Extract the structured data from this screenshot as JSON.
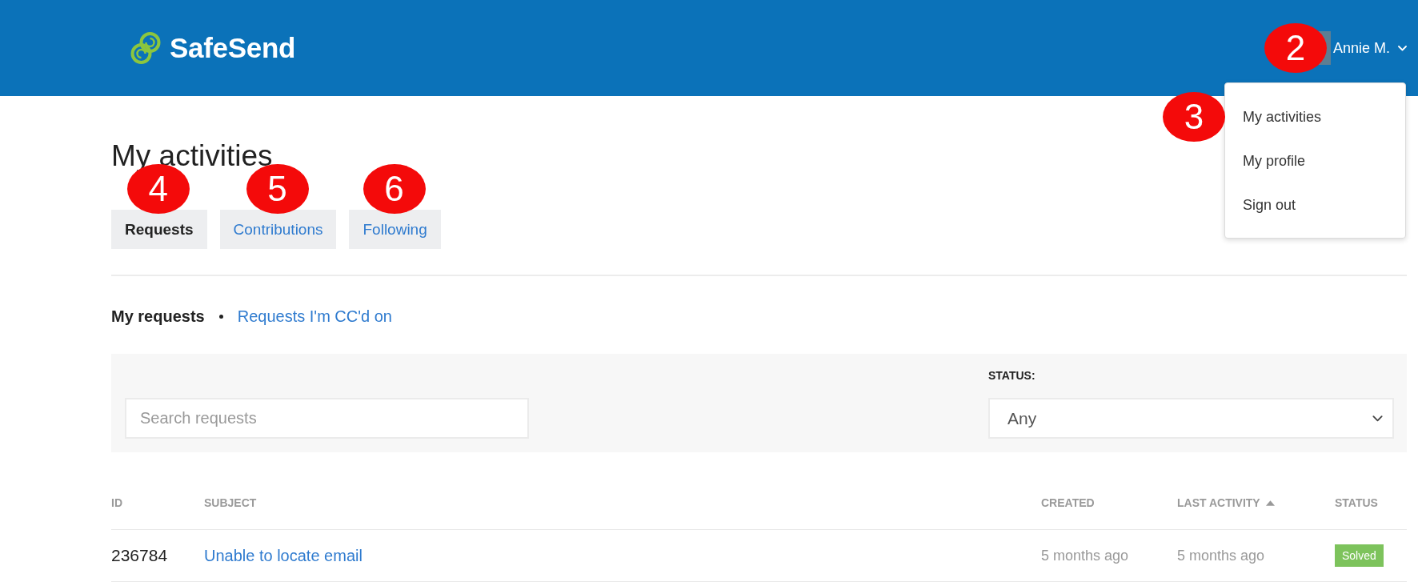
{
  "header": {
    "logo": {
      "text": "SafeSend"
    },
    "user": {
      "name": "Annie M.",
      "callout": "2"
    },
    "user_menu": {
      "callout": "3",
      "items": [
        {
          "label": "My activities"
        },
        {
          "label": "My profile"
        },
        {
          "label": "Sign out"
        }
      ]
    }
  },
  "page": {
    "title": "My activities"
  },
  "tabs": [
    {
      "label": "Requests",
      "selected": true,
      "callout": "4"
    },
    {
      "label": "Contributions",
      "selected": false,
      "callout": "5"
    },
    {
      "label": "Following",
      "selected": false,
      "callout": "6"
    }
  ],
  "subnav": [
    {
      "label": "My requests",
      "selected": true
    },
    {
      "label": "Requests I'm CC'd on",
      "selected": false
    }
  ],
  "filters": {
    "search": {
      "placeholder": "Search requests"
    },
    "status": {
      "label": "STATUS:",
      "value": "Any"
    }
  },
  "table": {
    "columns": [
      {
        "label": "ID",
        "sorted": false
      },
      {
        "label": "SUBJECT",
        "sorted": false
      },
      {
        "label": "CREATED",
        "sorted": false
      },
      {
        "label": "LAST ACTIVITY",
        "sorted": true
      },
      {
        "label": "STATUS",
        "sorted": false
      }
    ],
    "rows": [
      {
        "id": "236784",
        "subject": "Unable to locate email",
        "created": "5 months ago",
        "last_activity": "5 months ago",
        "status": {
          "label": "Solved",
          "color": "#7dc35c"
        }
      }
    ]
  }
}
